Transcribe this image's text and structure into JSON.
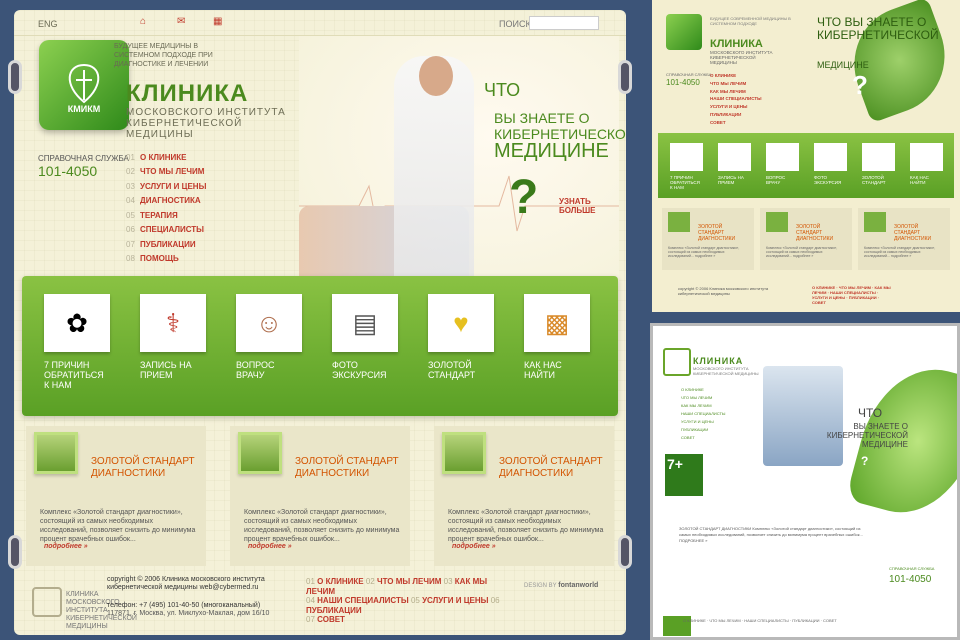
{
  "main": {
    "topbar": {
      "lang": "ENG",
      "search_label": "ПОИСК",
      "search_placeholder": ""
    },
    "tagline": "БУДУЩЕЕ МЕДИЦИНЫ В СИСТЕМНОМ ПОДХОДЕ ПРИ ДИАГНОСТИКЕ И ЛЕЧЕНИИ",
    "logo_text": "КМИКМ",
    "title": "КЛИНИКА",
    "subtitle": "МОСКОВСКОГО ИНСТИТУТА КИБЕРНЕТИЧЕСКОЙ МЕДИЦИНЫ",
    "phone_label": "СПРАВОЧНАЯ СЛУЖБА",
    "phone": "101-4050",
    "menu": [
      {
        "num": "01",
        "label": "О КЛИНИКЕ"
      },
      {
        "num": "02",
        "label": "ЧТО МЫ ЛЕЧИМ"
      },
      {
        "num": "03",
        "label": "УСЛУГИ И ЦЕНЫ"
      },
      {
        "num": "04",
        "label": "ДИАГНОСТИКА"
      },
      {
        "num": "05",
        "label": "ТЕРАПИЯ"
      },
      {
        "num": "06",
        "label": "СПЕЦИАЛИСТЫ"
      },
      {
        "num": "07",
        "label": "ПУБЛИКАЦИИ"
      },
      {
        "num": "08",
        "label": "ПОМОЩЬ"
      }
    ],
    "hero": {
      "line1": "ЧТО",
      "line2": "ВЫ ЗНАЕТЕ О КИБЕРНЕТИЧЕСКОЙ",
      "line3": "МЕДИЦИНЕ",
      "qmark": "?",
      "cta": "УЗНАТЬ БОЛЬШЕ"
    },
    "features": [
      {
        "label": "7 ПРИЧИН ОБРАТИТЬСЯ К НАМ",
        "icon": "flower-icon"
      },
      {
        "label": "ЗАПИСЬ НА ПРИЕМ",
        "icon": "stethoscope-icon"
      },
      {
        "label": "ВОПРОС ВРАЧУ",
        "icon": "doctor-icon"
      },
      {
        "label": "ФОТО ЭКСКУРСИЯ",
        "icon": "xray-icon"
      },
      {
        "label": "ЗОЛОТОЙ СТАНДАРТ",
        "icon": "capsules-icon"
      },
      {
        "label": "КАК НАС НАЙТИ",
        "icon": "map-icon"
      }
    ],
    "articles": [
      {
        "title": "ЗОЛОТОЙ СТАНДАРТ ДИАГНОСТИКИ",
        "body": "Комплекс «Золотой стандарт диагностики», состоящий из самых необходимых исследований, позволяет снизить до минимума процент врачебных ошибок...",
        "more": "подробнее »"
      },
      {
        "title": "ЗОЛОТОЙ СТАНДАРТ ДИАГНОСТИКИ",
        "body": "Комплекс «Золотой стандарт диагностики», состоящий из самых необходимых исследований, позволяет снизить до минимума процент врачебных ошибок...",
        "more": "подробнее »"
      },
      {
        "title": "ЗОЛОТОЙ СТАНДАРТ ДИАГНОСТИКИ",
        "body": "Комплекс «Золотой стандарт диагностики», состоящий из самых необходимых исследований, позволяет снизить до минимума процент врачебных ошибок...",
        "more": "подробнее »"
      }
    ],
    "footer": {
      "logo_text": "КЛИНИКА МОСКОВСКОГО ИНСТИТУТА КИБЕРНЕТИЧЕСКОЙ МЕДИЦИНЫ",
      "copyright": "copyright © 2006 Клиника московского института кибернетической медицины web@cybermed.ru",
      "tel": "телефон: +7 (495) 101-40-50 (многоканальный)",
      "address": "117871, г. Москва, ул. Миклухо-Маклая, дом 16/10",
      "nav": [
        {
          "num": "01",
          "label": "О КЛИНИКЕ"
        },
        {
          "num": "02",
          "label": "ЧТО МЫ ЛЕЧИМ"
        },
        {
          "num": "03",
          "label": "КАК МЫ ЛЕЧИМ"
        },
        {
          "num": "04",
          "label": "НАШИ СПЕЦИАЛИСТЫ"
        },
        {
          "num": "05",
          "label": "УСЛУГИ И ЦЕНЫ"
        },
        {
          "num": "06",
          "label": "ПУБЛИКАЦИИ"
        },
        {
          "num": "07",
          "label": "СОВЕТ"
        }
      ],
      "design_label": "DESIGN BY",
      "design_name": "fontanworld"
    }
  },
  "top_right": {
    "tagline": "БУДУЩЕЕ СОВРЕМЕННОЙ МЕДИЦИНЫ В СИСТЕМНОМ ПОДХОДЕ",
    "title": "КЛИНИКА",
    "subtitle": "МОСКОВСКОГО ИНСТИТУТА КИБЕРНЕТИЧЕСКОЙ МЕДИЦИНЫ",
    "phone_label": "СПРАВОЧНАЯ СЛУЖБА",
    "phone": "101-4050",
    "menu": [
      "О КЛИНИКЕ",
      "ЧТО МЫ ЛЕЧИМ",
      "КАК МЫ ЛЕЧИМ",
      "НАШИ СПЕЦИАЛИСТЫ",
      "УСЛУГИ И ЦЕНЫ",
      "ПУБЛИКАЦИИ",
      "СОВЕТ"
    ],
    "hero_line1": "ЧТО ВЫ ЗНАЕТЕ О КИБЕРНЕТИЧЕСКОЙ",
    "hero_line2": "МЕДИЦИНЕ",
    "qmark": "?",
    "features": [
      "7 ПРИЧИН ОБРАТИТЬСЯ К НАМ",
      "ЗАПИСЬ НА ПРИЕМ",
      "ВОПРОС ВРАЧУ",
      "ФОТО ЭКСКУРСИЯ",
      "ЗОЛОТОЙ СТАНДАРТ",
      "КАК НАС НАЙТИ"
    ],
    "articles": [
      {
        "title": "ЗОЛОТОЙ СТАНДАРТ ДИАГНОСТИКИ",
        "body": "Комплекс «Золотой стандарт диагностики», состоящий из самых необходимых исследований... подробнее »"
      },
      {
        "title": "ЗОЛОТОЙ СТАНДАРТ ДИАГНОСТИКИ",
        "body": "Комплекс «Золотой стандарт диагностики», состоящий из самых необходимых исследований... подробнее »"
      },
      {
        "title": "ЗОЛОТОЙ СТАНДАРТ ДИАГНОСТИКИ",
        "body": "Комплекс «Золотой стандарт диагностики», состоящий из самых необходимых исследований... подробнее »"
      }
    ],
    "footer": "copyright © 2006 Клиника московского института кибернетической медицины",
    "footer_nav": "О КЛИНИКЕ · ЧТО МЫ ЛЕЧИМ · КАК МЫ ЛЕЧИМ · НАШИ СПЕЦИАЛИСТЫ · УСЛУГИ И ЦЕНЫ · ПУБЛИКАЦИИ · СОВЕТ"
  },
  "bottom_right": {
    "title": "КЛИНИКА",
    "subtitle": "МОСКОВСКОГО ИНСТИТУТА КИБЕРНЕТИЧЕСКОЙ МЕДИЦИНЫ",
    "menu": [
      "О КЛИНИКЕ",
      "ЧТО МЫ ЛЕЧИМ",
      "КАК МЫ ЛЕЧИМ",
      "НАШИ СПЕЦИАЛИСТЫ",
      "УСЛУГИ И ЦЕНЫ",
      "ПУБЛИКАЦИИ",
      "СОВЕТ"
    ],
    "hero_line1": "ЧТО",
    "hero_line2": "ВЫ ЗНАЕТЕ О КИБЕРНЕТИЧЕСКОЙ МЕДИЦИНЕ",
    "qmark": "?",
    "badge": "7+",
    "text": "ЗОЛОТОЙ СТАНДАРТ ДИАГНОСТИКИ Комплекс «Золотой стандарт диагностики», состоящий из самых необходимых исследований, позволяет снизить до минимума процент врачебных ошибок... ПОДРОБНЕЕ »",
    "phone_label": "СПРАВОЧНАЯ СЛУЖБА",
    "phone": "101-4050",
    "footer": "О КЛИНИКЕ · ЧТО МЫ ЛЕЧИМ · НАШИ СПЕЦИАЛИСТЫ · ПУБЛИКАЦИИ · СОВЕТ"
  },
  "colors": {
    "accent_green": "#4b8a1e",
    "link_red": "#c0392b",
    "cream": "#f4f1d8"
  }
}
